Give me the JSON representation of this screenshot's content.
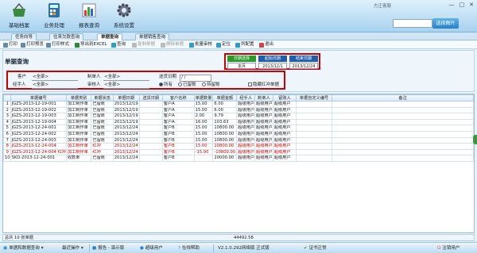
{
  "nav": [
    {
      "label": "基础档案",
      "icon": "basket-icon"
    },
    {
      "label": "业务处理",
      "icon": "calculator-icon"
    },
    {
      "label": "报表查询",
      "icon": "bar-chart-icon"
    },
    {
      "label": "系统设置",
      "icon": "gear-icon"
    }
  ],
  "corner_text": "方正客服",
  "search": {
    "button_label": "选择图片",
    "value": ""
  },
  "tabs": [
    "任务向导",
    "往来欠款查询",
    "单据查询",
    "单据销售查询"
  ],
  "toolbar": [
    "打印",
    "打印预览",
    "打印样式",
    "导出到EXCEL",
    "查询",
    "复制单据",
    "删除单据",
    "批量审核",
    "定位",
    "列配置",
    "退出"
  ],
  "page_title": "单据查询",
  "dates": {
    "h1": "日期选择",
    "h2": "起始日期",
    "h3": "结束日期",
    "v1": "本月",
    "v2": "2013/12/1",
    "v3": "2013/12/24"
  },
  "filters": {
    "customer_label": "客户",
    "customer_value": "<全部>",
    "maker_label": "制单人",
    "maker_value": "<全部>",
    "ship_label": "送货日期",
    "ship_value": "/ /",
    "handler_label": "经手人",
    "handler_value": "<全部>",
    "auditor_label": "审核人",
    "auditor_value": "<全部>",
    "r1": "所有",
    "r2": "已留账",
    "r3": "待留账",
    "hide_label": "隐藏红冲单据"
  },
  "table": {
    "headers": [
      "",
      "单据编号",
      "单据类别",
      "单据状态",
      "单据日期",
      "送货日期",
      "客户名称",
      "单据数量",
      "单据金额",
      "经手人",
      "制单人",
      "留账人",
      "单据自定义编号",
      "备注"
    ],
    "rows": [
      [
        "1",
        "JGZS-2013-12-19-001",
        "加工制作单",
        "已留账",
        "2013/12/19",
        "",
        "客户A",
        "15.00",
        "6.00",
        "超级用户",
        "超级用户",
        "超级用户",
        "",
        ""
      ],
      [
        "2",
        "JGZS-2013-12-19-002",
        "加工制作单",
        "已留账",
        "2013/12/19",
        "",
        "客户A",
        "15.00",
        "6.00",
        "超级用户",
        "超级用户",
        "超级用户",
        "",
        ""
      ],
      [
        "3",
        "JGZS-2013-12-19-003",
        "加工制作单",
        "已留账",
        "2013/12/19",
        "",
        "客户A",
        "2.00",
        "9.79",
        "超级用户",
        "超级用户",
        "超级用户",
        "",
        ""
      ],
      [
        "4",
        "JGZS-2013-12-19-004",
        "加工制作单",
        "已留账",
        "2013/12/19",
        "",
        "客户A",
        "16.00",
        "103.63",
        "超级用户",
        "超级用户",
        "超级用户",
        "",
        ""
      ],
      [
        "5",
        "JGZS-2013-12-24-001",
        "加工制作单",
        "已留账",
        "2013/12/24",
        "",
        "客户B",
        "15.00",
        "10800.00",
        "超级用户",
        "超级用户",
        "超级用户",
        "",
        ""
      ],
      [
        "6",
        "JGZS-2013-12-24-002",
        "加工制作单",
        "已留账",
        "2013/12/24",
        "",
        "客户B",
        "15.00",
        "10800.00",
        "超级用户",
        "超级用户",
        "超级用户",
        "",
        ""
      ],
      [
        "7",
        "JGZS-2013-12-24-003",
        "加工制作单",
        "已留账",
        "2013/12/24",
        "",
        "客户B",
        "15.00",
        "10800.00",
        "超级用户",
        "超级用户",
        "超级用户",
        "",
        ""
      ],
      [
        "8",
        "JGZS-2013-12-24-004",
        "加工制作单",
        "红冲",
        "2013/12/24",
        "",
        "客户B",
        "15.00",
        "10800.00",
        "超级用户",
        "超级用户",
        "超级用户",
        "",
        ""
      ],
      [
        "9",
        "JGZS-2013-12-24-004 红冲",
        "加工制作单",
        "红冲",
        "2013/12/24",
        "",
        "客户B",
        "-15.00",
        "-10800.00",
        "超级用户",
        "超级用户",
        "超级用户",
        "",
        ""
      ],
      [
        "10",
        "SKD-2013-12-24-001",
        "收款单",
        "已留账",
        "2013/12/24",
        "",
        "客户B",
        "",
        "20000.00",
        "超级用户",
        "超级用户",
        "超级用户",
        "",
        ""
      ]
    ],
    "red_rows": [
      7,
      8
    ]
  },
  "summary": {
    "count_text": "总共 10 张单据",
    "amount_total": "44492.58"
  },
  "status": [
    "单据和数据查询",
    "最近操作",
    "报告 - 演示版",
    "超级用户",
    "在线帮助",
    "V2.1.0.292网络版 正式版",
    "证书正常",
    "注销用户"
  ]
}
